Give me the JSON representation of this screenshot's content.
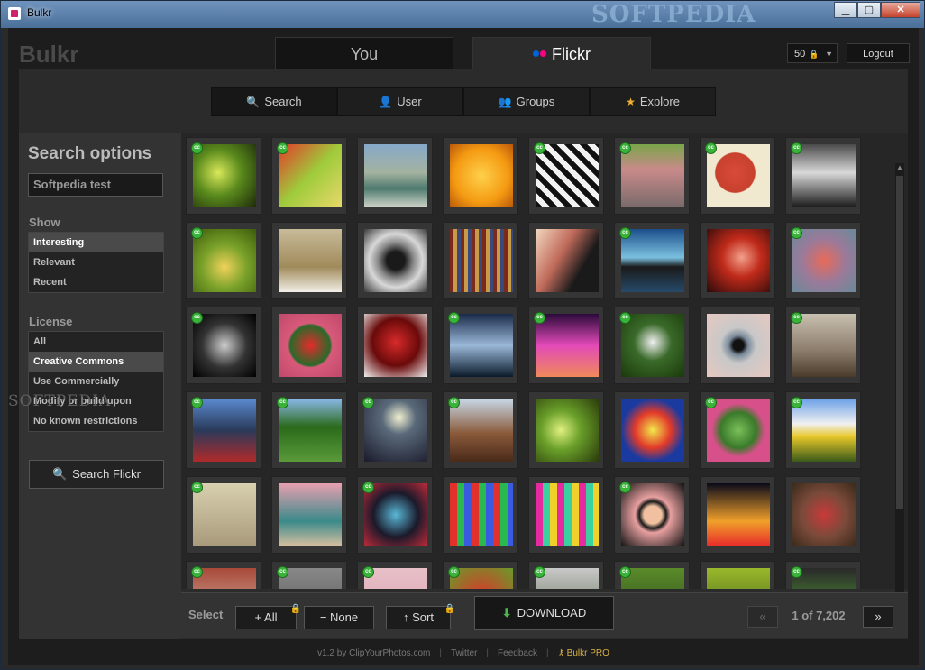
{
  "window": {
    "title": "Bulkr",
    "watermark": "SOFTPEDIA"
  },
  "header": {
    "logo": "Bulkr",
    "tabs": [
      {
        "label": "You"
      },
      {
        "label": "Flickr"
      }
    ],
    "counter": "50",
    "logout": "Logout"
  },
  "subtabs": [
    {
      "label": "Search",
      "icon": "magnifier-icon"
    },
    {
      "label": "User",
      "icon": "user-icon"
    },
    {
      "label": "Groups",
      "icon": "groups-icon"
    },
    {
      "label": "Explore",
      "icon": "star-icon"
    }
  ],
  "sidebar": {
    "title": "Search options",
    "query": "Softpedia test",
    "show_label": "Show",
    "show_options": [
      "Interesting",
      "Relevant",
      "Recent"
    ],
    "license_label": "License",
    "license_options": [
      "All",
      "Creative Commons",
      "Use Commercially",
      "Modify or build upon",
      "No known restrictions"
    ],
    "search_button": "Search Flickr",
    "watermark": "SOFTPEDIA"
  },
  "bottom": {
    "select_label": "Select",
    "all_button": "+ All",
    "none_button": "− None",
    "sort_button": "↑ Sort",
    "download_button": "DOWNLOAD",
    "prev": "«",
    "page_text": "1 of 7,202",
    "next": "»"
  },
  "footer": {
    "version": "v1.2 by  ClipYourPhotos.com",
    "twitter": "Twitter",
    "feedback": "Feedback",
    "pro": "Bulkr PRO"
  },
  "colors": {
    "accent_gold": "#d8b24a",
    "cc_green": "#3ab33a",
    "flickr_blue": "#0063dc",
    "flickr_pink": "#ff0084"
  },
  "thumbs": [
    {
      "cc": true,
      "bg": "radial-gradient(circle at 40% 45%,#d9e85a,#5a8a1c 45%,#1d2a0a)"
    },
    {
      "cc": true,
      "bg": "linear-gradient(135deg,#e43a2a,#9ecb3b 50%,#e8d86a)"
    },
    {
      "cc": false,
      "bg": "linear-gradient(#86a9c9,#a4b2a0 45%,#4e7a6e 70%,#cfd3c8)"
    },
    {
      "cc": false,
      "bg": "radial-gradient(circle,#ffd04a,#f49a12 60%,#b9580a)"
    },
    {
      "cc": true,
      "bg": "repeating-linear-gradient(45deg,#111 0 6px,#f2f2f2 6px 12px)"
    },
    {
      "cc": true,
      "bg": "linear-gradient(#7aa64a,#c98a8a 40%,#7a6a6a)"
    },
    {
      "cc": true,
      "bg": "radial-gradient(circle at 45% 45%,#d84a3a,#c8402e 40%,#f1e8d0 42%)"
    },
    {
      "cc": true,
      "bg": "linear-gradient(#4a4a4a,#d9d9d9 45%,#1a1a1a)"
    },
    {
      "cc": true,
      "bg": "radial-gradient(circle at 50% 60%,#f0d25a,#7aa22a 45%,#3c5a0a)"
    },
    {
      "cc": false,
      "bg": "linear-gradient(#c8bb9a,#a08a5a 60%,#f2efe6)"
    },
    {
      "cc": false,
      "bg": "radial-gradient(circle,#1a1a1a 20%,#8a8a8a 40%,#d8d8d8 60%,#3a3a3a)"
    },
    {
      "cc": false,
      "bg": "repeating-linear-gradient(90deg,#7a2a1a 0 4px,#c89a4a 4px 8px,#3a4a7a 8px 12px)"
    },
    {
      "cc": false,
      "bg": "linear-gradient(120deg,#f2d8c0,#c06a5a 40%,#1a1a1a 70%)"
    },
    {
      "cc": true,
      "bg": "linear-gradient(#1c4e8a,#7ac0e0 45%,#1a1a1a 60%,#264a6a)"
    },
    {
      "cc": false,
      "bg": "radial-gradient(circle at 55% 45%,#f2a08a,#c02a1a 40%,#2a0a0a)"
    },
    {
      "cc": true,
      "bg": "radial-gradient(circle,#e86a5a,#9a7a9a 50%,#6a8a9a)"
    },
    {
      "cc": true,
      "bg": "radial-gradient(circle at 50% 50%,#ccc,#333 50%,#000)"
    },
    {
      "cc": false,
      "bg": "radial-gradient(circle,#e62a2a,#2a6a2a 45%,#d85a7a 50%,#c0486a)"
    },
    {
      "cc": false,
      "bg": "radial-gradient(circle at 50% 45%,#d82a2a,#6a0a0a 50%,#f0f0f0)"
    },
    {
      "cc": true,
      "bg": "linear-gradient(#1a2a4a,#9ab8d8 50%,#0a1a2a)"
    },
    {
      "cc": true,
      "bg": "linear-gradient(#2a0a3a,#e24ab8 50%,#f08a5a)"
    },
    {
      "cc": true,
      "bg": "radial-gradient(circle at 50% 45%,#f0f0f0,#3a6a2a 40%,#1a3a0a)"
    },
    {
      "cc": false,
      "bg": "radial-gradient(circle,#111 12%,#7a8a9a 22%,#c8c8c8 40%,#e8c8c0)"
    },
    {
      "cc": true,
      "bg": "linear-gradient(#c8c0b0,#8a7a6a 60%,#4a3a2a)"
    },
    {
      "cc": true,
      "bg": "linear-gradient(#5a8ad0,#2a3a5a 50%,#b02a2a)"
    },
    {
      "cc": true,
      "bg": "linear-gradient(#8ab8e8,#2a6a1a 45%,#5a9a3a)"
    },
    {
      "cc": true,
      "bg": "radial-gradient(circle at 55% 30%,#f0f0d0,#5a6a7a 30%,#1a1a2a)"
    },
    {
      "cc": true,
      "bg": "linear-gradient(#c8d8e8,#8a5a3a 55%,#4a2a1a)"
    },
    {
      "cc": false,
      "bg": "radial-gradient(circle at 40% 50%,#e0f080,#6aa02a 40%,#2a3a0a)"
    },
    {
      "cc": false,
      "bg": "radial-gradient(circle,#f2e84a,#e23a2a 40%,#1a3aa0 70%)"
    },
    {
      "cc": true,
      "bg": "radial-gradient(circle,#7ac05a,#3a7a2a 40%,#d8508a 60%)"
    },
    {
      "cc": true,
      "bg": "linear-gradient(#6aa0e8,#f0f0f0 40%,#e8c82a 60%,#3a5a1a)"
    },
    {
      "cc": true,
      "bg": "linear-gradient(#d8d0b0,#a89a7a)"
    },
    {
      "cc": false,
      "bg": "linear-gradient(#e8a0b0,#3a8a8a 60%,#d8c0a0)"
    },
    {
      "cc": true,
      "bg": "radial-gradient(circle,#5ab8d8,#1a1a2a 50%,#c02a3a)"
    },
    {
      "cc": false,
      "bg": "repeating-linear-gradient(90deg,#e2302a 0 8px,#2ab850 8px 16px,#3a5ae0 16px 24px)"
    },
    {
      "cc": false,
      "bg": "repeating-linear-gradient(90deg,#e82aa0 0 8px,#3ad0a0 8px 16px,#f0d02a 16px 24px)"
    },
    {
      "cc": true,
      "bg": "radial-gradient(circle,#f0c0a0 20%,#1a1a1a 30%,#e8a0a0 40%,#111)"
    },
    {
      "cc": false,
      "bg": "linear-gradient(#0a0a1a,#f0a02a 60%,#e82a2a)"
    },
    {
      "cc": false,
      "bg": "radial-gradient(circle,#c83a3a,#7a4a3a 50%,#3a2a1a)"
    },
    {
      "cc": true,
      "bg": "linear-gradient(#a84a3a,#d8c0b0)"
    },
    {
      "cc": true,
      "bg": "linear-gradient(#888,#555)"
    },
    {
      "cc": true,
      "bg": "linear-gradient(#e8c0c8,#d8a0b0)"
    },
    {
      "cc": true,
      "bg": "radial-gradient(circle,#e2302a,#6a9a2a)"
    },
    {
      "cc": true,
      "bg": "linear-gradient(#c8c8c8,#5a6a4a)"
    },
    {
      "cc": true,
      "bg": "linear-gradient(#5a8a2a,#2a4a1a)"
    },
    {
      "cc": false,
      "bg": "linear-gradient(#9ab82a,#3a5a1a)"
    },
    {
      "cc": true,
      "bg": "linear-gradient(#2a2a2a,#5ab83a)"
    }
  ]
}
